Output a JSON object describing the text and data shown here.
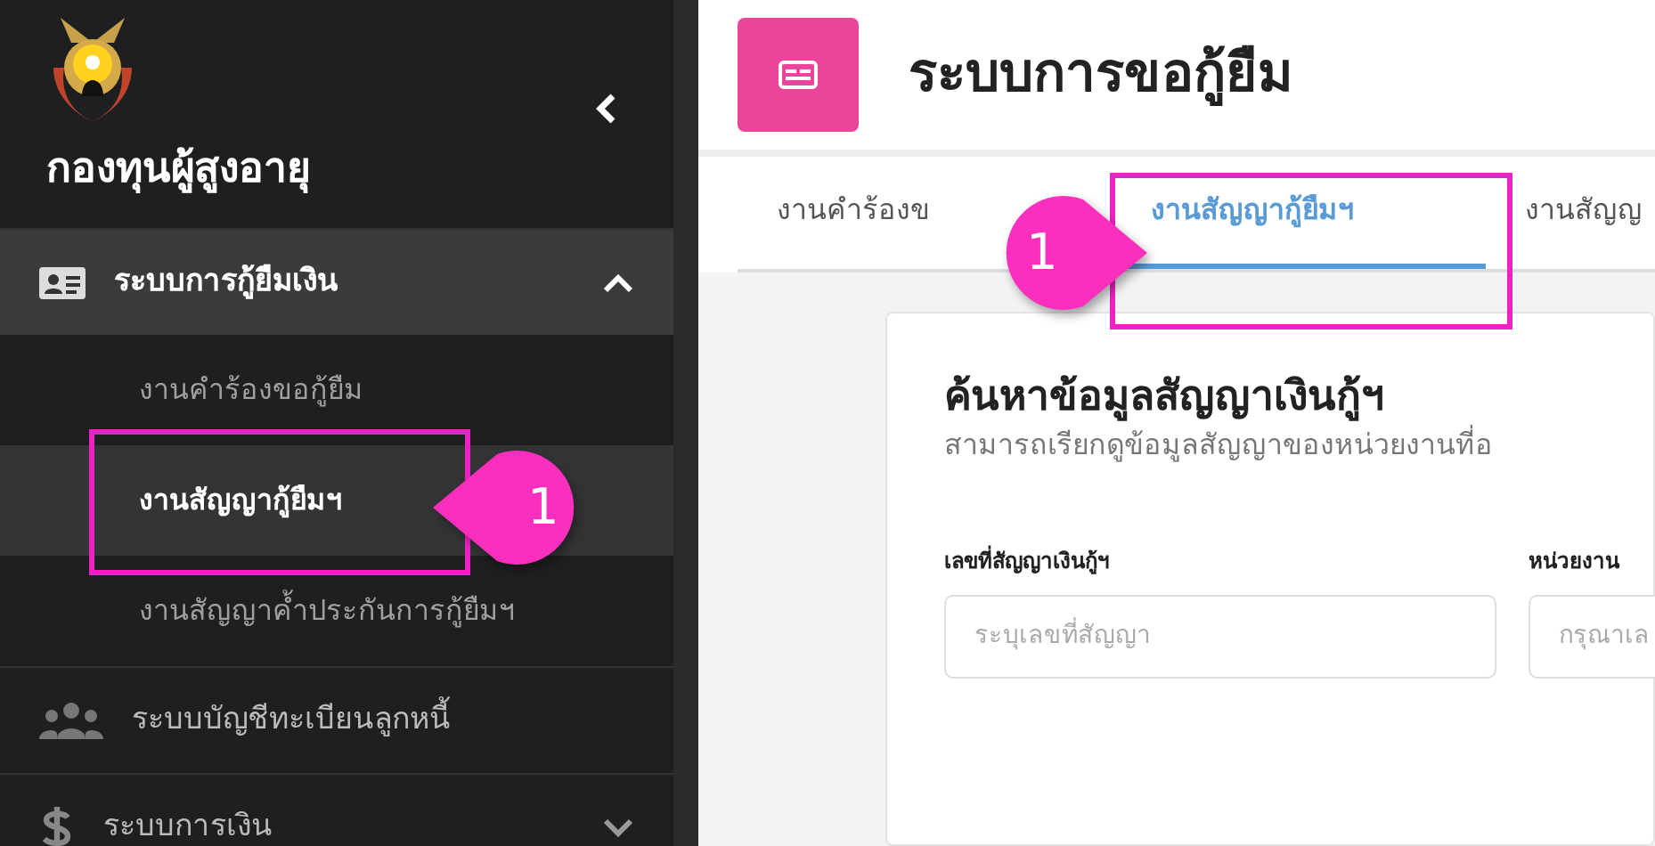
{
  "sidebar": {
    "brand": "กองทุนผู้สูงอายุ",
    "menu": [
      {
        "label": "ระบบการกู้ยืมเงิน",
        "expanded": true,
        "children": [
          {
            "label": "งานคำร้องขอกู้ยืม",
            "selected": false
          },
          {
            "label": "งานสัญญากู้ยืมฯ",
            "selected": true
          },
          {
            "label": "งานสัญญาค้ำประกันการกู้ยืมฯ",
            "selected": false
          }
        ]
      },
      {
        "label": "ระบบบัญชีทะเบียนลูกหนี้"
      },
      {
        "label": "ระบบการเงิน",
        "expanded": false
      }
    ]
  },
  "page": {
    "title": "ระบบการขอกู้ยืม"
  },
  "tabs": [
    {
      "label": "งานคำร้องข",
      "selected": false
    },
    {
      "label": "งานสัญญากู้ยืมฯ",
      "selected": true
    },
    {
      "label": "งานสัญญ",
      "selected": false
    }
  ],
  "search_card": {
    "title": "ค้นหาข้อมูลสัญญาเงินกู้ฯ",
    "subtitle": "สามารถเรียกดูข้อมูลสัญญาของหน่วยงานที่อ",
    "fields": [
      {
        "label": "เลขที่สัญญาเงินกู้ฯ",
        "placeholder": "ระบุเลขที่สัญญา"
      },
      {
        "label": "หน่วยงาน",
        "placeholder": "กรุณาเล"
      }
    ]
  },
  "annotations": [
    {
      "label": "1"
    },
    {
      "label": "1"
    }
  ]
}
